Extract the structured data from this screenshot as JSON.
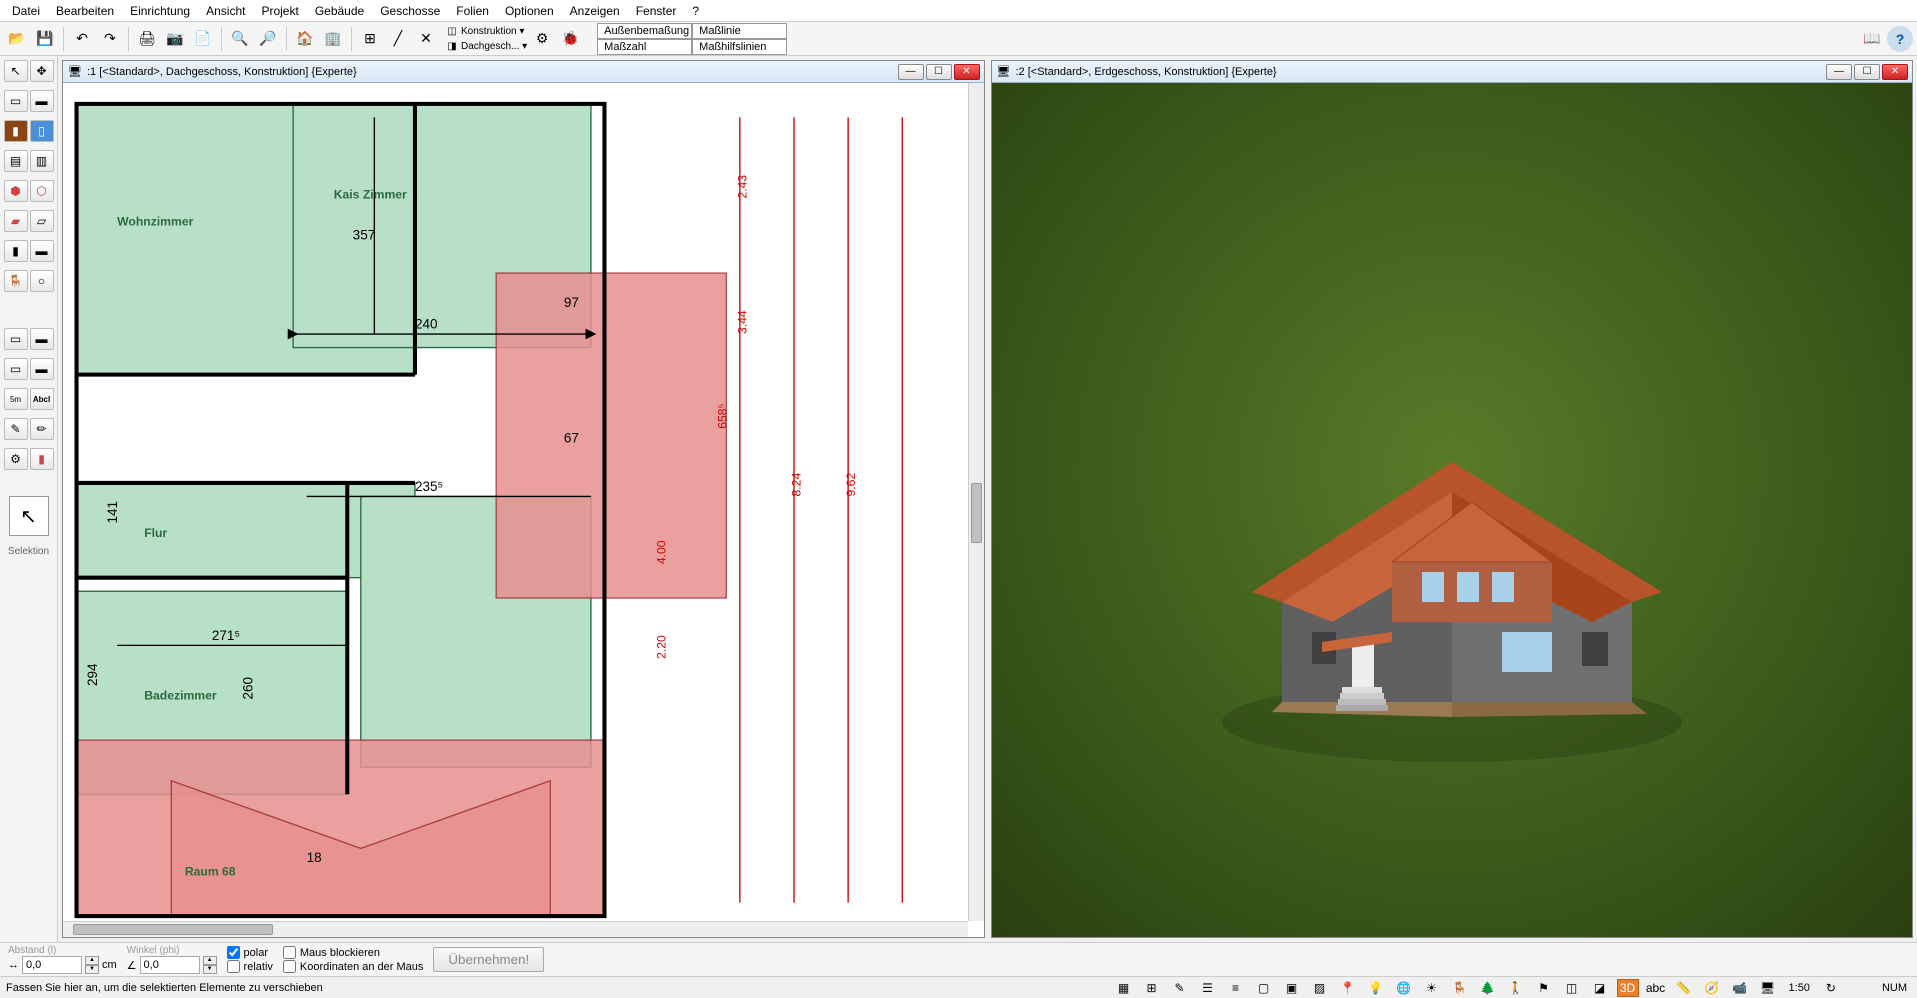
{
  "menu": [
    "Datei",
    "Bearbeiten",
    "Einrichtung",
    "Ansicht",
    "Projekt",
    "Gebäude",
    "Geschosse",
    "Folien",
    "Optionen",
    "Anzeigen",
    "Fenster",
    "?"
  ],
  "toolbar": {
    "drop1_label": "Konstruktion ▾",
    "drop2_label": "Dachgesch... ▾",
    "dim": {
      "a": "Außenbemaßung",
      "b": "Maßlinie",
      "c": "Maßzahl",
      "d": "Maßhilfslinien"
    }
  },
  "left_panel": {
    "selection_label": "Selektion"
  },
  "pane1": {
    "title": ":1 [<Standard>, Dachgeschoss, Konstruktion]  {Experte}",
    "rooms": {
      "wohnzimmer": "Wohnzimmer",
      "kais": "Kais Zimmer",
      "flur": "Flur",
      "bad": "Badezimmer",
      "raum68": "Raum 68"
    },
    "dims": {
      "d240": "240",
      "d357": "357",
      "d2355": "235⁵",
      "d2715": "271⁵",
      "d260": "260",
      "d294": "294",
      "d141": "141",
      "d67": "67",
      "d97": "97",
      "d18": "18",
      "d658": "658⁵",
      "d243": "2.43",
      "d344": "3.44",
      "d220": "2.20",
      "d400": "4.00",
      "d824": "8.24",
      "d962": "9.62"
    }
  },
  "pane2": {
    "title": ":2 [<Standard>, Erdgeschoss, Konstruktion]  {Experte}"
  },
  "bottombar": {
    "abstand_label": "Abstand (l)",
    "abstand_unit": "cm",
    "abstand_val": "0,0",
    "winkel_label": "Winkel (phi)",
    "winkel_val": "0,0",
    "polar": "polar",
    "relativ": "relativ",
    "maus_block": "Maus blockieren",
    "koord_maus": "Koordinaten an der Maus",
    "apply": "Übernehmen!"
  },
  "statusbar": {
    "hint": "Fassen Sie hier an, um die selektierten Elemente zu verschieben",
    "scale": "1:50",
    "num": "NUM",
    "d3": "3D",
    "abc": "abc"
  }
}
